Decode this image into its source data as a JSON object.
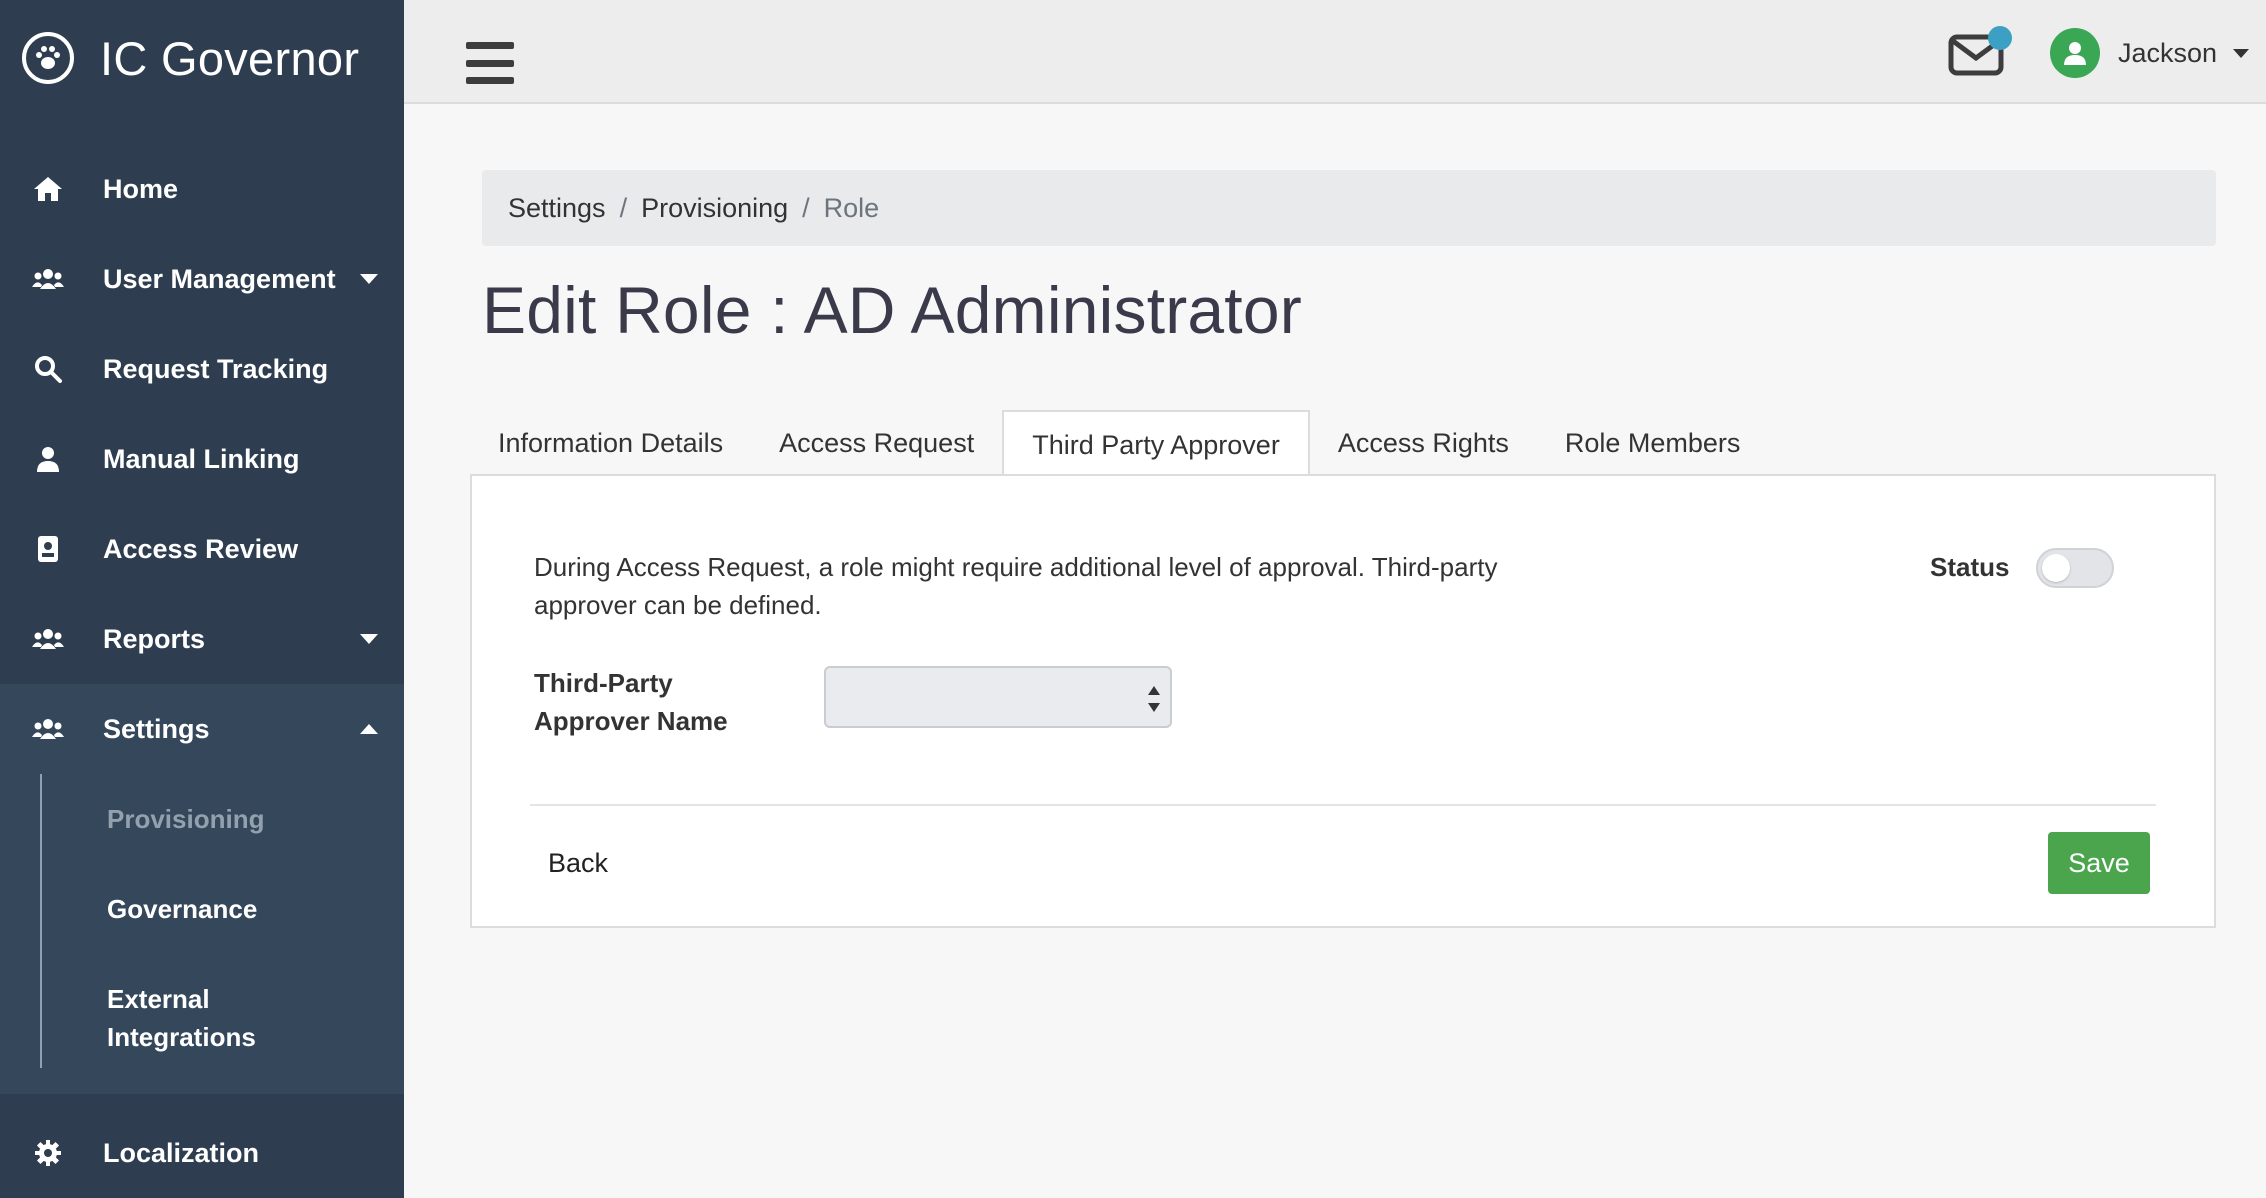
{
  "app": {
    "title": "IC Governor"
  },
  "sidebar": {
    "items": [
      {
        "label": "Home",
        "icon": "home-icon"
      },
      {
        "label": "User Management",
        "icon": "users-icon"
      },
      {
        "label": "Request Tracking",
        "icon": "search-icon"
      },
      {
        "label": "Manual Linking",
        "icon": "user-icon"
      },
      {
        "label": "Access Review",
        "icon": "id-badge-icon"
      },
      {
        "label": "Reports",
        "icon": "users-icon"
      },
      {
        "label": "Settings",
        "icon": "users-icon"
      }
    ],
    "settings_sub": [
      "Provisioning",
      "Governance",
      "External Integrations"
    ],
    "bottom": {
      "label": "Localization",
      "icon": "gear-icon"
    }
  },
  "topbar": {
    "user_name": "Jackson"
  },
  "breadcrumb": [
    "Settings",
    "Provisioning",
    "Role"
  ],
  "page": {
    "title": "Edit Role : AD Administrator"
  },
  "tabs": [
    "Information Details",
    "Access Request",
    "Third Party Approver",
    "Access Rights",
    "Role Members"
  ],
  "panel": {
    "description": "During Access Request, a role might require additional level of approval. Third-party approver can be defined.",
    "status_label": "Status",
    "status_on": false,
    "field_label": "Third-Party Approver Name",
    "field_value": "",
    "back_label": "Back",
    "save_label": "Save"
  },
  "colors": {
    "sidebar": "#2e3e50",
    "accent_save": "#4aa54c",
    "avatar": "#3aa755",
    "notification_dot": "#3c9fc4"
  }
}
